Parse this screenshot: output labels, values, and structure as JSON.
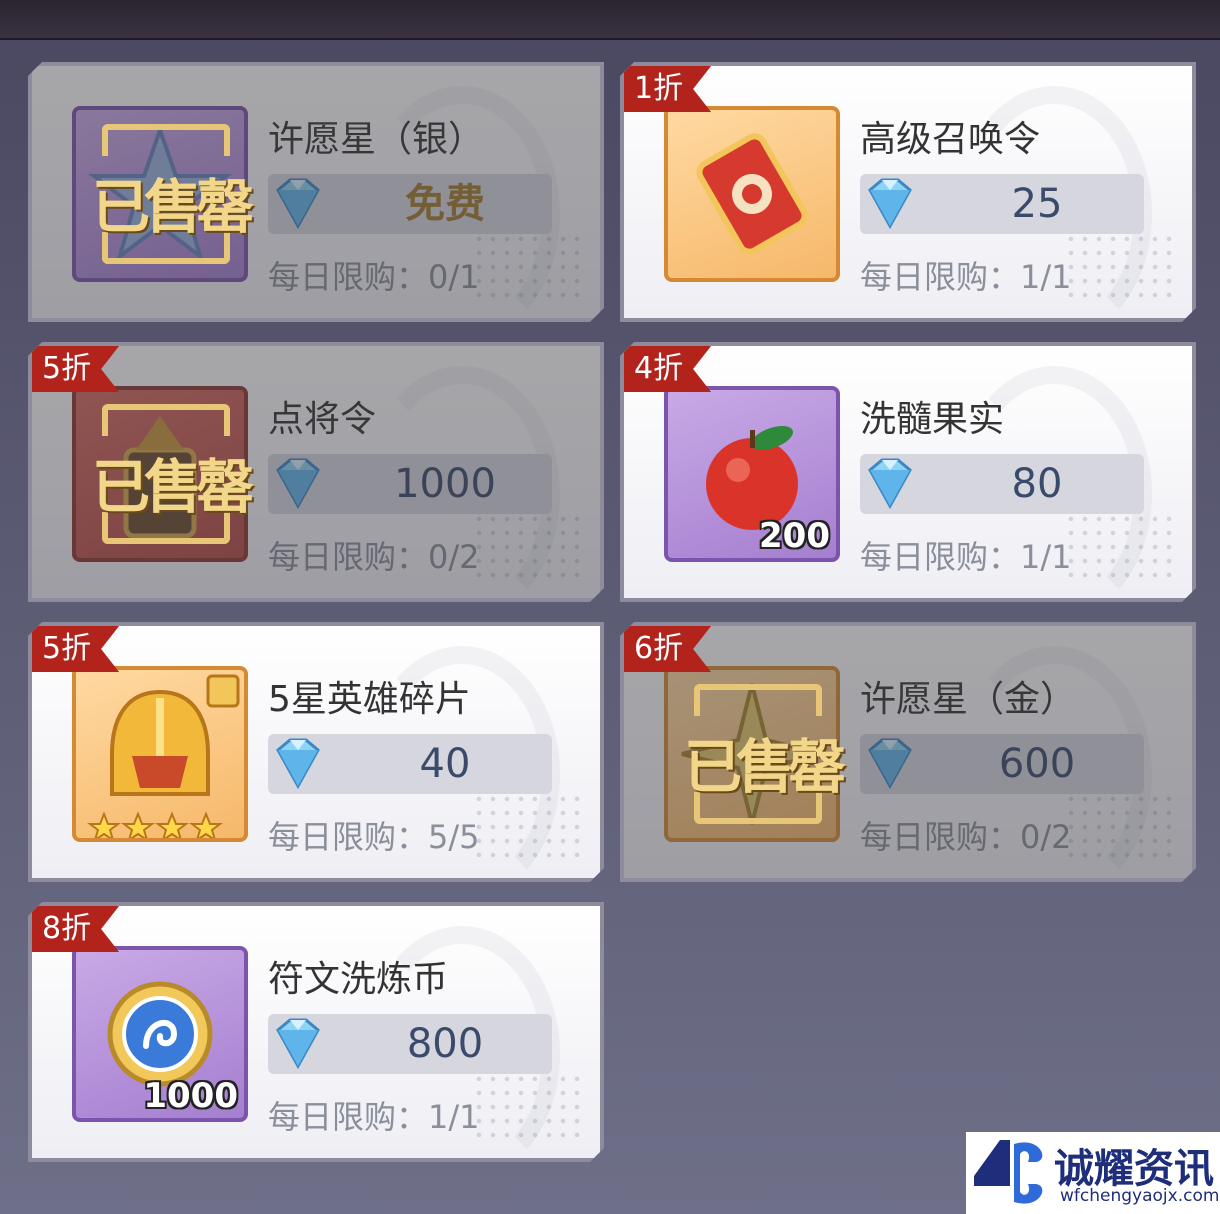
{
  "shop": {
    "items": [
      {
        "name": "许愿星（银）",
        "price": "免费",
        "limit": "每日限购：0/1",
        "discount": "",
        "quantity": "",
        "sold_label": "已售罄"
      },
      {
        "name": "高级召唤令",
        "price": "25",
        "limit": "每日限购：1/1",
        "discount": "1折",
        "quantity": "",
        "sold_label": ""
      },
      {
        "name": "点将令",
        "price": "1000",
        "limit": "每日限购：0/2",
        "discount": "5折",
        "quantity": "",
        "sold_label": "已售罄"
      },
      {
        "name": "洗髓果实",
        "price": "80",
        "limit": "每日限购：1/1",
        "discount": "4折",
        "quantity": "200",
        "sold_label": ""
      },
      {
        "name": "5星英雄碎片",
        "price": "40",
        "limit": "每日限购：5/5",
        "discount": "5折",
        "quantity": "",
        "sold_label": ""
      },
      {
        "name": "许愿星（金）",
        "price": "600",
        "limit": "每日限购：0/2",
        "discount": "6折",
        "quantity": "",
        "sold_label": "已售罄"
      },
      {
        "name": "符文洗炼币",
        "price": "800",
        "limit": "每日限购：1/1",
        "discount": "8折",
        "quantity": "1000",
        "sold_label": ""
      }
    ]
  },
  "watermark": {
    "logo_text": "4C",
    "name": "诚耀资讯",
    "url": "wfchengyaojx.com"
  }
}
